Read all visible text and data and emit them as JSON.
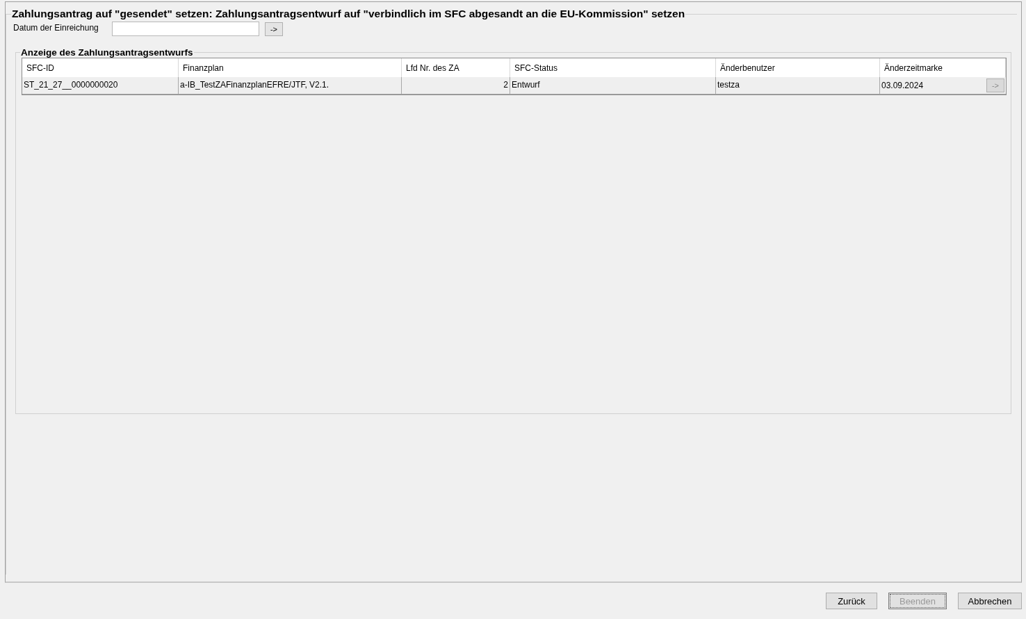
{
  "title": "Zahlungsantrag auf \"gesendet\" setzen: Zahlungsantragsentwurf auf \"verbindlich im SFC abgesandt an die EU-Kommission\" setzen",
  "date_field": {
    "label": "Datum der Einreichung",
    "button": "->"
  },
  "group": {
    "title": "Anzeige des Zahlungsantragsentwurfs",
    "columns": [
      "SFC-ID",
      "Finanzplan",
      "Lfd Nr. des ZA",
      "SFC-Status",
      "Änderbenutzer",
      "Änderzeitmarke"
    ],
    "rows": [
      {
        "cells": [
          "ST_21_27__0000000020",
          "a-IB_TestZAFinanzplanEFRE/JTF, V2.1.",
          "2",
          "Entwurf",
          "testza",
          "03.09.2024"
        ],
        "button": "->",
        "button_disabled": true
      }
    ]
  },
  "buttons": [
    {
      "label": "Zurück",
      "disabled": false
    },
    {
      "label": "Beenden",
      "disabled": true
    },
    {
      "label": "Abbrechen",
      "disabled": false
    }
  ]
}
